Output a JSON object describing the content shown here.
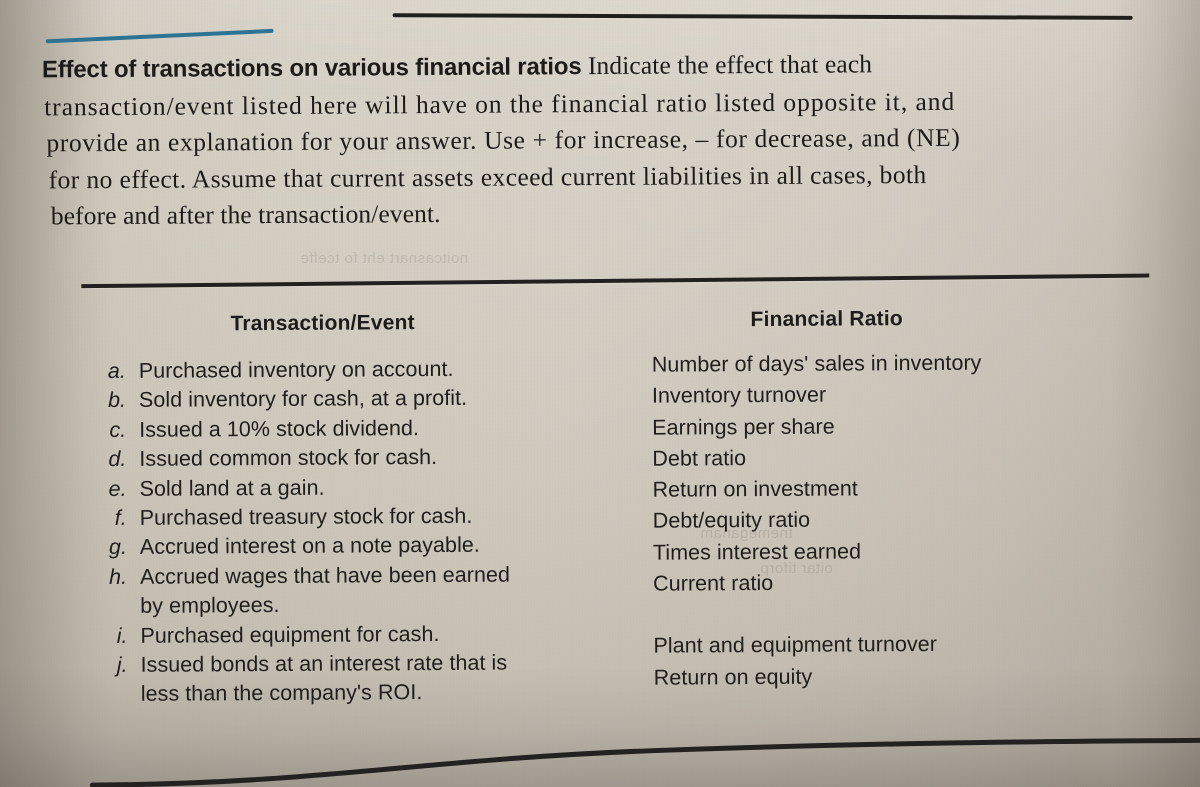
{
  "document": {
    "heading_lines": [
      {
        "strong": "Effect of transactions on various financial ratios",
        "rest": " Indicate the effect that each"
      },
      {
        "strong": "",
        "rest": "transaction/event listed here will have on the financial ratio listed opposite it, and"
      },
      {
        "strong": "",
        "rest": "provide an explanation for your answer. Use + for increase, – for decrease, and (NE)"
      },
      {
        "strong": "",
        "rest": "for no effect. Assume that current assets exceed current liabilities in all cases, both"
      },
      {
        "strong": "",
        "rest": "before and after the transaction/event."
      }
    ]
  },
  "table": {
    "headers": {
      "transaction": "Transaction/Event",
      "ratio": "Financial Ratio"
    },
    "transactions": [
      {
        "marker": "a.",
        "text": "Purchased inventory on account."
      },
      {
        "marker": "b.",
        "text": "Sold inventory for cash, at a profit."
      },
      {
        "marker": "c.",
        "text": "Issued a 10% stock dividend."
      },
      {
        "marker": "d.",
        "text": "Issued common stock for cash."
      },
      {
        "marker": "e.",
        "text": "Sold land at a gain."
      },
      {
        "marker": "f.",
        "text": "Purchased treasury stock for cash."
      },
      {
        "marker": "g.",
        "text": "Accrued interest on a note payable."
      },
      {
        "marker": "h.",
        "text": "Accrued wages that have been earned"
      },
      {
        "marker": "",
        "text": "by employees."
      },
      {
        "marker": "i.",
        "text": "Purchased equipment for cash."
      },
      {
        "marker": "j.",
        "text": "Issued bonds at an interest rate that is"
      },
      {
        "marker": "",
        "text": "less than the company's ROI."
      }
    ],
    "ratios": [
      "Number of days' sales in inventory",
      "Inventory turnover",
      "Earnings per share",
      "Debt ratio",
      "Return on investment",
      "Debt/equity ratio",
      "Times interest earned",
      "Current ratio",
      "Plant and equipment turnover",
      "Return on equity"
    ]
  },
  "decor": {
    "accent_color": "#2d7392",
    "rule_color": "#232120",
    "paper_color": "#cdc6ba",
    "text_color": "#201e1b"
  }
}
